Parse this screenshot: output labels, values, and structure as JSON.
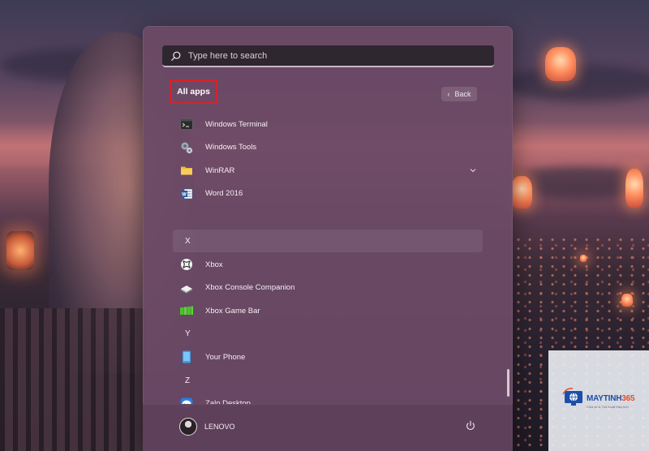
{
  "search": {
    "placeholder": "Type here to search"
  },
  "header": {
    "title": "All apps",
    "back_label": "Back"
  },
  "apps": [
    {
      "type": "app",
      "label": "Windows Terminal",
      "icon": "terminal-icon"
    },
    {
      "type": "app",
      "label": "Windows Tools",
      "icon": "gear-tools-icon"
    },
    {
      "type": "app",
      "label": "WinRAR",
      "icon": "folder-icon",
      "expandable": true
    },
    {
      "type": "app",
      "label": "Word 2016",
      "icon": "word-icon"
    },
    {
      "type": "letter",
      "label": "X"
    },
    {
      "type": "app",
      "label": "Xbox",
      "icon": "xbox-icon"
    },
    {
      "type": "app",
      "label": "Xbox Console Companion",
      "icon": "xbox-companion-icon"
    },
    {
      "type": "app",
      "label": "Xbox Game Bar",
      "icon": "xbox-game-bar-icon"
    },
    {
      "type": "letter",
      "label": "Y"
    },
    {
      "type": "app",
      "label": "Your Phone",
      "icon": "phone-icon"
    },
    {
      "type": "letter",
      "label": "Z"
    },
    {
      "type": "app",
      "label": "Zalo Desktop",
      "icon": "zalo-icon"
    }
  ],
  "footer": {
    "user_name": "LENOVO"
  },
  "watermark": {
    "brand_main": "MAYTINH",
    "brand_accent": "365",
    "tagline": "Chia sẻ & Thủ thuật Máy tính"
  },
  "colors": {
    "menu_bg": "#6c4a66",
    "highlight_border": "#d8222a",
    "text": "#f5eef4"
  }
}
